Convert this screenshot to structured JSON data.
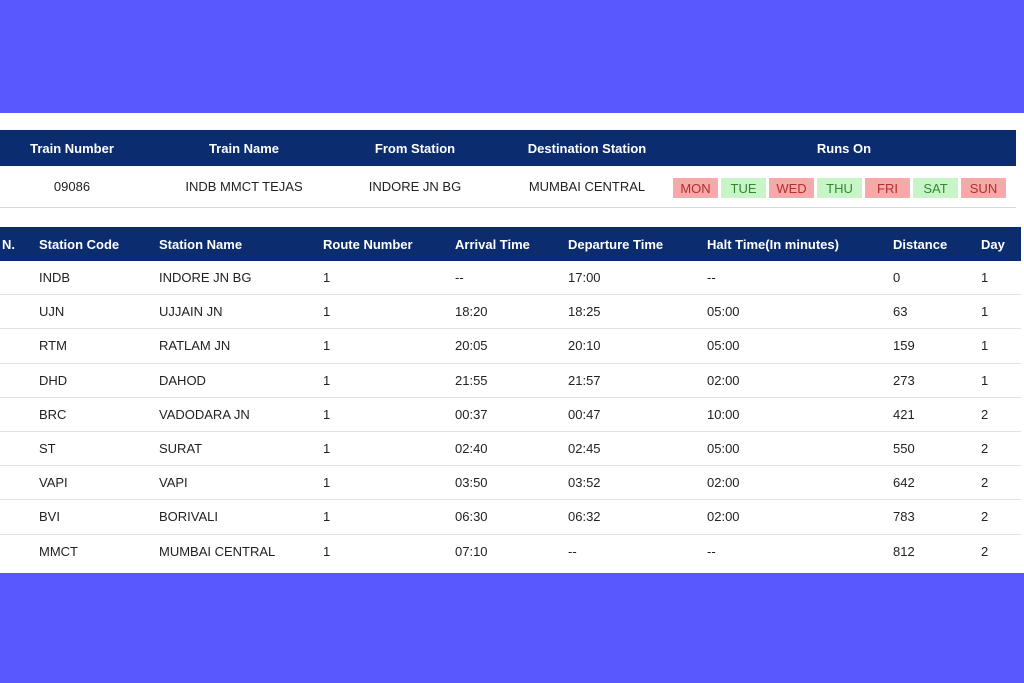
{
  "train_info": {
    "headers": {
      "number": "Train Number",
      "name": "Train Name",
      "from": "From Station",
      "destination": "Destination Station",
      "runs_on": "Runs On"
    },
    "values": {
      "number": "09086",
      "name": "INDB MMCT TEJAS",
      "from": "INDORE JN BG",
      "destination": "MUMBAI CENTRAL"
    },
    "days": [
      {
        "label": "MON",
        "runs": false
      },
      {
        "label": "TUE",
        "runs": true
      },
      {
        "label": "WED",
        "runs": false
      },
      {
        "label": "THU",
        "runs": true
      },
      {
        "label": "FRI",
        "runs": false
      },
      {
        "label": "SAT",
        "runs": true
      },
      {
        "label": "SUN",
        "runs": false
      }
    ]
  },
  "route": {
    "headers": {
      "sno": "N.",
      "code": "Station Code",
      "station": "Station Name",
      "route": "Route Number",
      "arrival": "Arrival Time",
      "departure": "Departure Time",
      "halt": "Halt Time(In minutes)",
      "distance": "Distance",
      "day": "Day"
    },
    "rows": [
      {
        "code": "INDB",
        "station": "INDORE JN BG",
        "route": "1",
        "arrival": "--",
        "departure": "17:00",
        "halt": "--",
        "distance": "0",
        "day": "1"
      },
      {
        "code": "UJN",
        "station": "UJJAIN JN",
        "route": "1",
        "arrival": "18:20",
        "departure": "18:25",
        "halt": "05:00",
        "distance": "63",
        "day": "1"
      },
      {
        "code": "RTM",
        "station": "RATLAM JN",
        "route": "1",
        "arrival": "20:05",
        "departure": "20:10",
        "halt": "05:00",
        "distance": "159",
        "day": "1"
      },
      {
        "code": "DHD",
        "station": "DAHOD",
        "route": "1",
        "arrival": "21:55",
        "departure": "21:57",
        "halt": "02:00",
        "distance": "273",
        "day": "1"
      },
      {
        "code": "BRC",
        "station": "VADODARA JN",
        "route": "1",
        "arrival": "00:37",
        "departure": "00:47",
        "halt": "10:00",
        "distance": "421",
        "day": "2"
      },
      {
        "code": "ST",
        "station": "SURAT",
        "route": "1",
        "arrival": "02:40",
        "departure": "02:45",
        "halt": "05:00",
        "distance": "550",
        "day": "2"
      },
      {
        "code": "VAPI",
        "station": "VAPI",
        "route": "1",
        "arrival": "03:50",
        "departure": "03:52",
        "halt": "02:00",
        "distance": "642",
        "day": "2"
      },
      {
        "code": "BVI",
        "station": "BORIVALI",
        "route": "1",
        "arrival": "06:30",
        "departure": "06:32",
        "halt": "02:00",
        "distance": "783",
        "day": "2"
      },
      {
        "code": "MMCT",
        "station": "MUMBAI CENTRAL",
        "route": "1",
        "arrival": "07:10",
        "departure": "--",
        "halt": "--",
        "distance": "812",
        "day": "2"
      }
    ]
  },
  "colors": {
    "background": "#5858ff",
    "header": "#0b2d6f",
    "runs_day": "#c8f5c8",
    "no_run_day": "#f7a8a8"
  }
}
